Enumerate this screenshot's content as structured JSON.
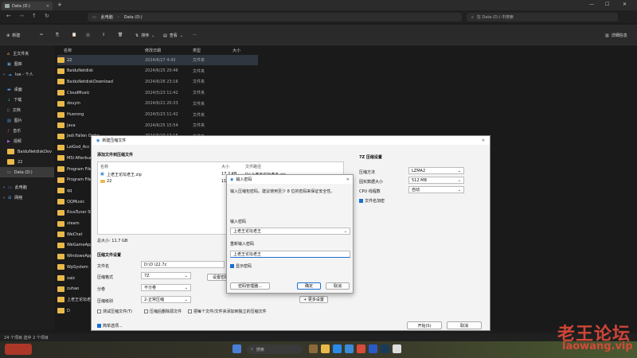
{
  "window": {
    "tab_title": "Data (D:)",
    "address": [
      "此电脑",
      "Data (D:)"
    ],
    "search_placeholder": "在 Data (D:) 中搜索"
  },
  "commandbar": {
    "new": "新建",
    "sort": "排序",
    "view": "查看",
    "details": "详细信息"
  },
  "sidebar": {
    "items": [
      "主文件夹",
      "图库",
      "lue - 个人",
      "桌面",
      "下载",
      "文档",
      "图片",
      "音乐",
      "视频",
      "BaiduNetdiskDov",
      "22",
      "Data (D:)",
      "此电脑",
      "网络"
    ]
  },
  "filelist": {
    "headers": [
      "名称",
      "修改日期",
      "类型",
      "大小"
    ],
    "rows": [
      {
        "name": "22",
        "date": "2024/6/27 4:43",
        "type": "文件夹"
      },
      {
        "name": "BaiduNetdisk",
        "date": "2024/6/25 20:46",
        "type": "文件夹"
      },
      {
        "name": "BaiduNetdiskDownload",
        "date": "2024/6/26 23:16",
        "type": "文件夹"
      },
      {
        "name": "CloudMusic",
        "date": "2024/5/23 11:42",
        "type": "文件夹"
      },
      {
        "name": "douyin",
        "date": "2024/6/21 20:33",
        "type": "文件夹"
      },
      {
        "name": "Huorong",
        "date": "2024/5/23 11:42",
        "type": "文件夹"
      },
      {
        "name": "Java",
        "date": "2024/6/25 15:54",
        "type": "文件夹"
      },
      {
        "name": "Jedi Fallen Order",
        "date": "2024/5/23 17:15",
        "type": "文件夹"
      },
      {
        "name": "LeiGod_Acc",
        "date": "",
        "type": ""
      },
      {
        "name": "MSI Afterburn",
        "date": "",
        "type": ""
      },
      {
        "name": "Program Files",
        "date": "",
        "type": ""
      },
      {
        "name": "Program Files",
        "date": "",
        "type": ""
      },
      {
        "name": "qq",
        "date": "",
        "type": ""
      },
      {
        "name": "QQMusic",
        "date": "",
        "type": ""
      },
      {
        "name": "RivaTuner Stat",
        "date": "",
        "type": ""
      },
      {
        "name": "steam",
        "date": "",
        "type": ""
      },
      {
        "name": "WeChat",
        "date": "",
        "type": ""
      },
      {
        "name": "WeGameApps",
        "date": "",
        "type": ""
      },
      {
        "name": "WindowsApps",
        "date": "",
        "type": ""
      },
      {
        "name": "WpSystem",
        "date": "",
        "type": ""
      },
      {
        "name": "xaiz",
        "date": "",
        "type": ""
      },
      {
        "name": "zuhao",
        "date": "",
        "type": ""
      },
      {
        "name": "上老王论坛老王",
        "date": "",
        "type": ""
      },
      {
        "name": "D",
        "date": "",
        "type": ""
      }
    ]
  },
  "statusbar": {
    "text": "24 个项目  选中 2 个项目"
  },
  "taskbar": {
    "search": "搜索"
  },
  "watermark": {
    "line1": "老王论坛",
    "line2": "laowang.vip"
  },
  "archive_dialog": {
    "title": "新建压缩文件",
    "add_section": "添加文件到压缩文件",
    "col_name": "名称",
    "col_size": "大小",
    "col_path": "文件路径",
    "files": [
      {
        "name": "上老王论坛老王.zip",
        "size": "17.2 KB",
        "path": "D:\\上老王论坛老王.zip"
      },
      {
        "name": "22",
        "size": "11.7 GB",
        "path": ""
      }
    ],
    "total": "总大小: 11.7 GB",
    "settings_section": "压缩文件设置",
    "file_label": "文件名",
    "file_value": "D:\\D \\22.7z",
    "format_label": "压缩格式",
    "format_value": "7Z",
    "volume_label": "分卷",
    "volume_value": "不分卷",
    "level_label": "压缩级别",
    "level_value": "2-正常压缩",
    "set_password": "设置密码",
    "more_settings": "+ 更多设置",
    "chk_test": "测试压缩文件(T)",
    "chk_delete": "压缩后删除源文件",
    "chk_each": "把每个文件/文件夹添加到独立的压缩文件",
    "simple_mode": "简单选项...",
    "start": "开始(S)",
    "cancel": "取消",
    "right_section": "7Z 压缩设置",
    "method_label": "压缩方法",
    "method_value": "LZMA2",
    "dict_label": "固实数据大小",
    "dict_value": "512 MB",
    "cpu_label": "CPU 线程数",
    "cpu_value": "自动",
    "encrypt_names": "文件名加密"
  },
  "password_dialog": {
    "title": "输入密码",
    "hint": "输入压缩包密码。建议使用至少 8 位的密码来保证安全性。",
    "enter_label": "输入密码",
    "enter_value": "上老王论坛老王",
    "reenter_label": "重新输入密码",
    "reenter_value": "上老王论坛老王",
    "show_password": "显示密码",
    "manager": "密码管理器...",
    "ok": "确定",
    "cancel": "取消"
  },
  "colors": {
    "accent": "#1a6fd0",
    "folder": "#e9b94a",
    "watermark": "#e24a3b"
  }
}
